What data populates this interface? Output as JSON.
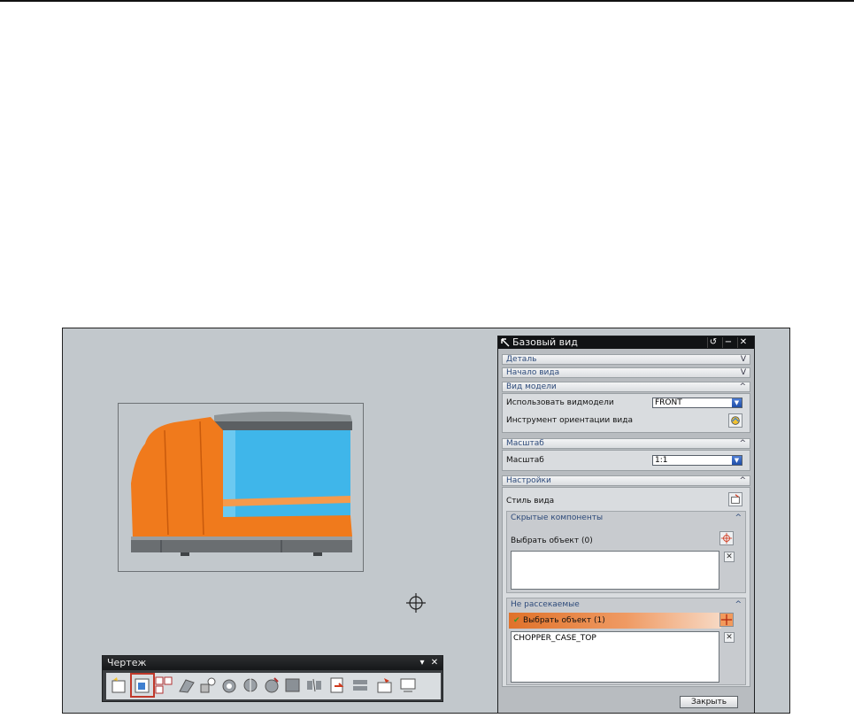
{
  "toolbar": {
    "title": "Чертеж",
    "dropdown_glyph": "▾",
    "close_glyph": "✕"
  },
  "dialog": {
    "title": "Базовый вид",
    "reset_glyph": "↺",
    "minimize_glyph": "−",
    "close_glyph": "✕",
    "sections": {
      "detail": "Деталь",
      "view_origin": "Начало вида",
      "model_view": "Вид модели",
      "scale": "Масштаб",
      "settings": "Настройки"
    },
    "model_view": {
      "use_label": "Использовать видмодели",
      "use_value": "FRONT",
      "orient_label": "Инструмент ориентации вида"
    },
    "scale": {
      "label": "Масштаб",
      "value": "1:1"
    },
    "settings": {
      "style_label": "Стиль вида",
      "hidden": {
        "title": "Скрытые компоненты",
        "select_label": "Выбрать объект (0)"
      },
      "non_section": {
        "title": "Не рассекаемые",
        "select_label": "Выбрать объект (1)",
        "items": [
          "CHOPPER_CASE_TOP"
        ]
      }
    },
    "close_button": "Закрыть",
    "chevron_down": "V",
    "chevron_up": "^",
    "remove_glyph": "✕",
    "combo_arrow": "▼"
  },
  "colors": {
    "viewport_bg": "#c2c8cc",
    "model_orange": "#f07a1c",
    "model_blue": "#3fb6ea",
    "selection_orange": "#e0722a"
  }
}
